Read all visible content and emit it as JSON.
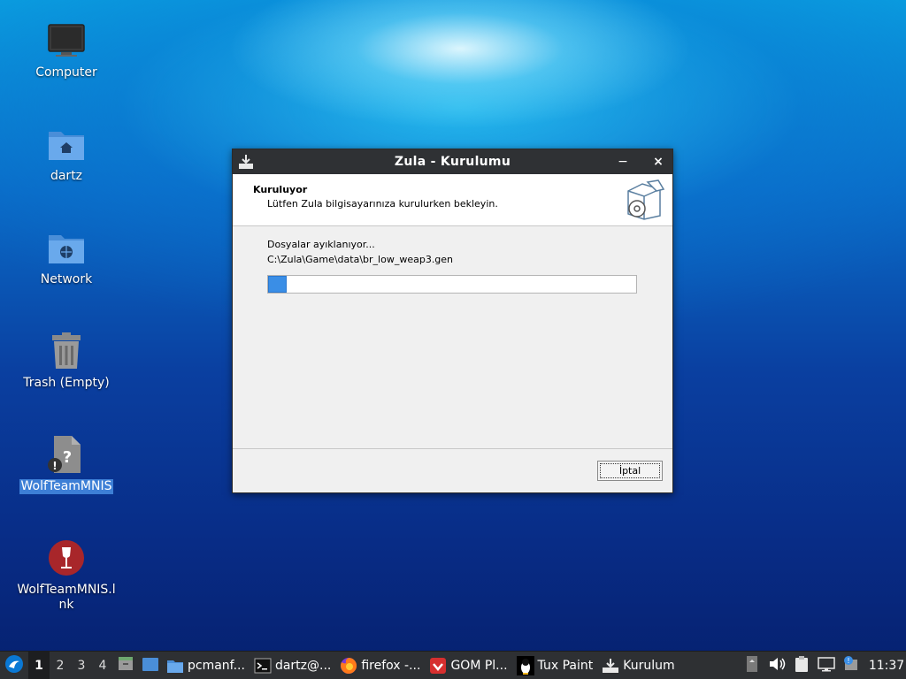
{
  "desktop": {
    "icons": [
      {
        "label": "Computer"
      },
      {
        "label": "dartz"
      },
      {
        "label": "Network"
      },
      {
        "label": "Trash (Empty)"
      },
      {
        "label": "WolfTeamMNIS"
      },
      {
        "label": "WolfTeamMNIS.lnk"
      }
    ]
  },
  "dialog": {
    "title": "Zula - Kurulumu",
    "header_title": "Kuruluyor",
    "header_subtitle": "Lütfen Zula bilgisayarınıza kurulurken bekleyin.",
    "status_text": "Dosyalar ayıklanıyor...",
    "current_file": "C:\\Zula\\Game\\data\\br_low_weap3.gen",
    "progress_fraction": 0.05,
    "cancel_label": "İptal",
    "minimize_glyph": "−",
    "close_glyph": "×"
  },
  "taskbar": {
    "workspaces": [
      "1",
      "2",
      "3",
      "4"
    ],
    "active_workspace": "1",
    "tasks": [
      {
        "label": "pcmanf...",
        "icon": "folder-icon"
      },
      {
        "label": "dartz@...",
        "icon": "terminal-icon"
      },
      {
        "label": "firefox -...",
        "icon": "firefox-icon"
      },
      {
        "label": "GOM Pl...",
        "icon": "gom-player-icon"
      },
      {
        "label": "Tux Paint",
        "icon": "tux-paint-icon"
      },
      {
        "label": "Kurulum",
        "icon": "installer-icon"
      }
    ],
    "clock": "11:37"
  },
  "colors": {
    "accent": "#3a8ee6",
    "selection": "#3d7fd6",
    "titlebar": "#2f3134",
    "taskbar": "#2e3033"
  }
}
